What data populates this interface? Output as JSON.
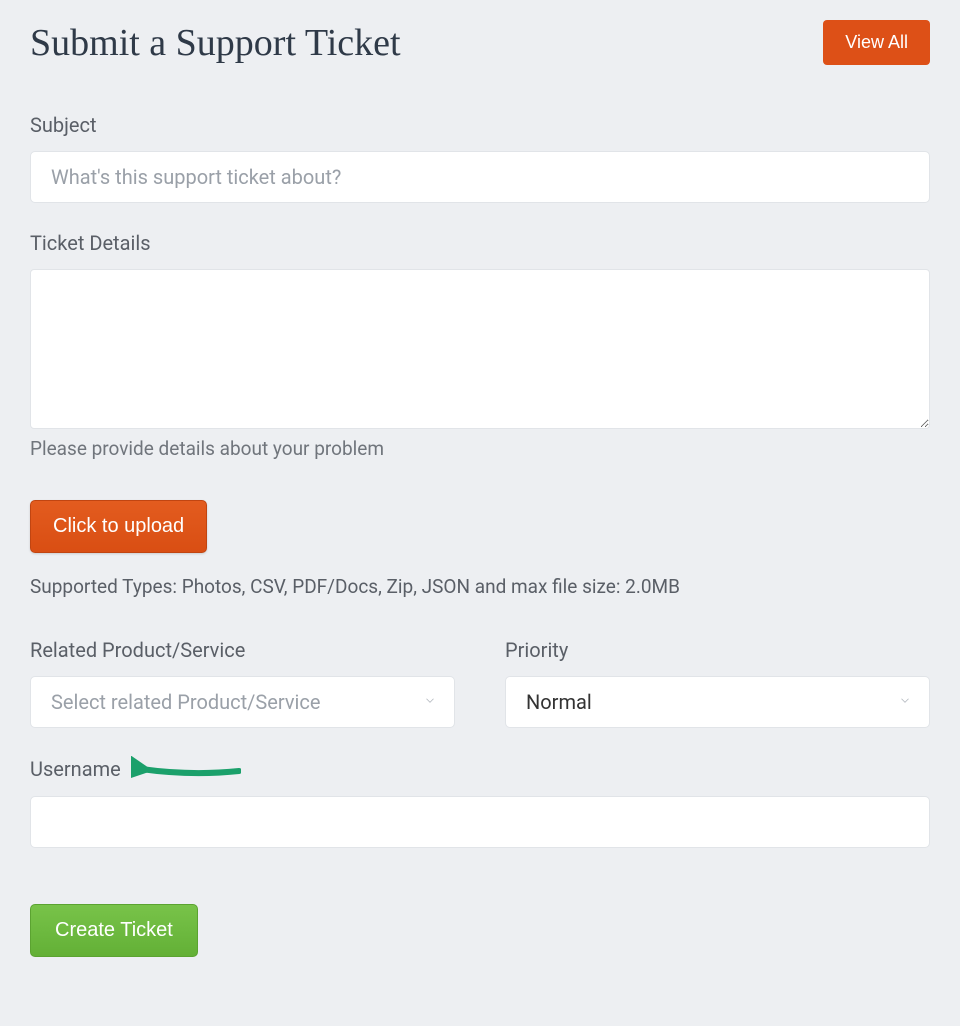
{
  "header": {
    "title": "Submit a Support Ticket",
    "view_all_label": "View All"
  },
  "form": {
    "subject": {
      "label": "Subject",
      "placeholder": "What's this support ticket about?",
      "value": ""
    },
    "ticket_details": {
      "label": "Ticket Details",
      "value": "",
      "helper": "Please provide details about your problem"
    },
    "upload": {
      "button_label": "Click to upload",
      "supported_types": "Supported Types: Photos, CSV, PDF/Docs, Zip, JSON and max file size: 2.0MB"
    },
    "related_product": {
      "label": "Related Product/Service",
      "placeholder": "Select related Product/Service",
      "value": ""
    },
    "priority": {
      "label": "Priority",
      "value": "Normal"
    },
    "username": {
      "label": "Username",
      "value": ""
    },
    "submit_label": "Create Ticket"
  }
}
